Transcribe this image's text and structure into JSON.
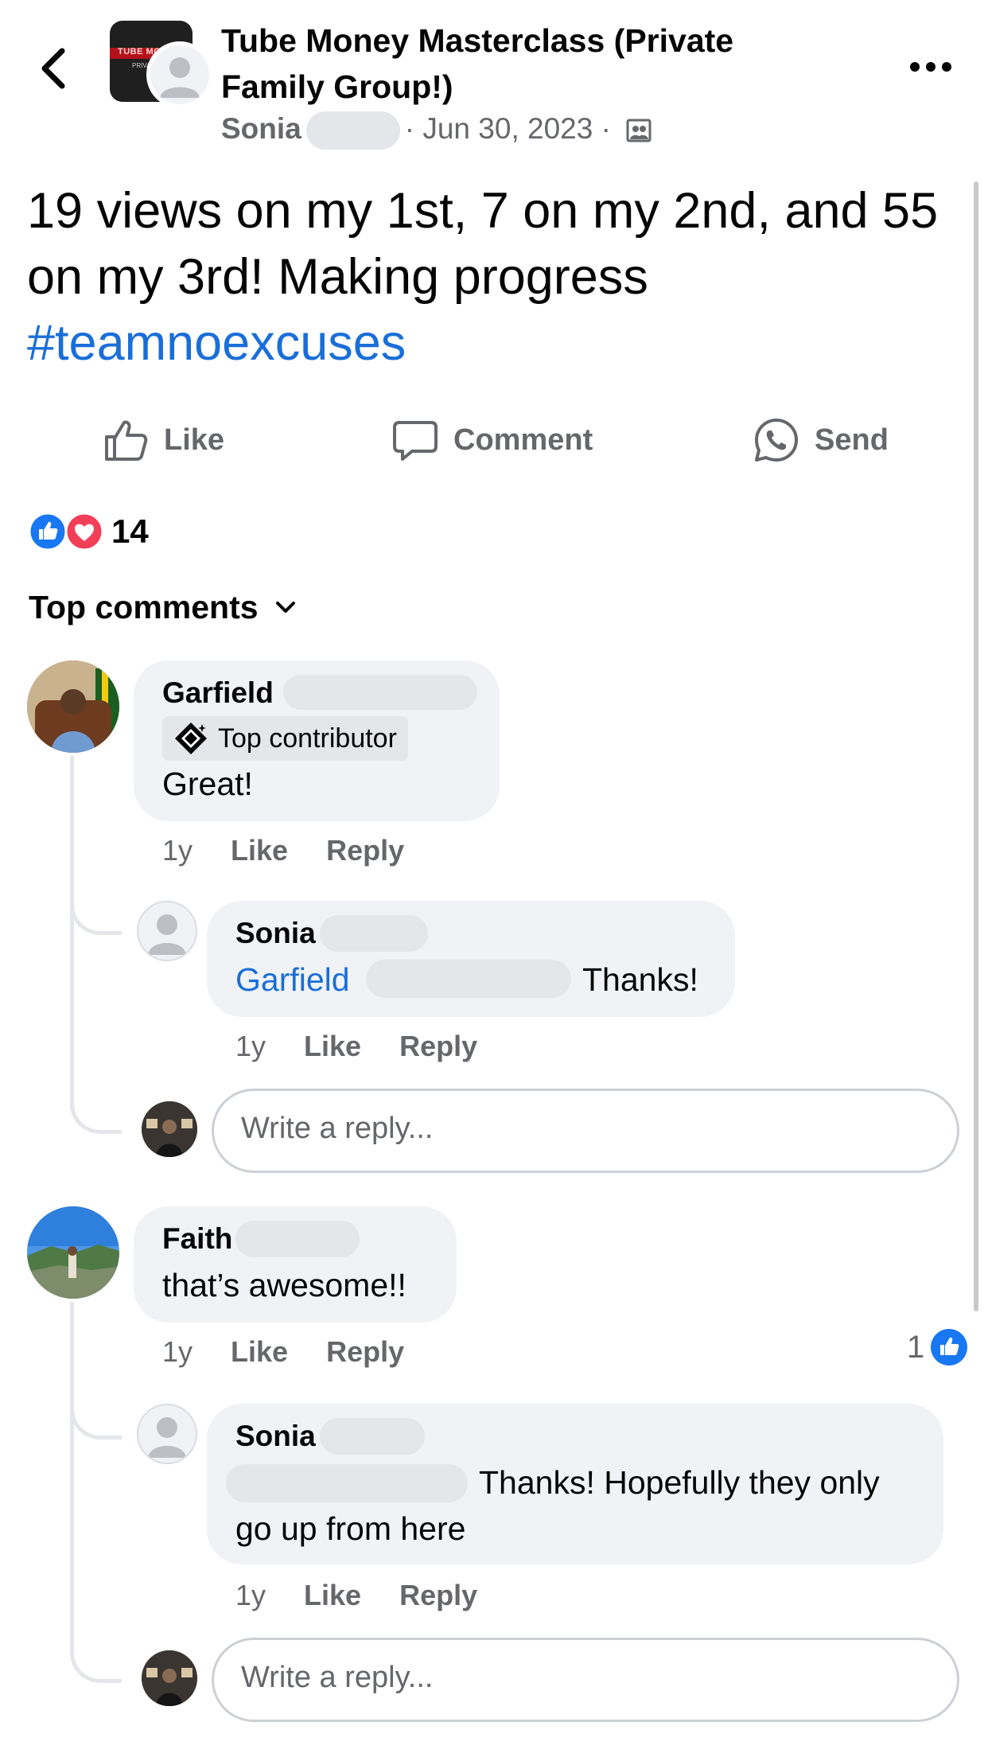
{
  "header": {
    "group_name": "Tube Money Masterclass (Private Family Group!)",
    "group_avatar_text": "TUBE MONEY",
    "group_avatar_subtext": "PRIVATE F",
    "author": "Sonia",
    "date": "Jun 30, 2023",
    "separator": "·",
    "audience_icon": "members-icon"
  },
  "post": {
    "text": "19 views on my 1st, 7 on my 2nd, and 55 on my 3rd! Making progress",
    "hashtag": "#teamnoexcuses"
  },
  "actions": {
    "like": "Like",
    "comment": "Comment",
    "send": "Send"
  },
  "reactions": {
    "count": "14",
    "types": [
      "like",
      "love"
    ]
  },
  "top_comments_label": "Top comments",
  "comments": [
    {
      "name": "Garfield",
      "badge": "Top contributor",
      "text": "Great!",
      "time": "1y",
      "like": "Like",
      "reply": "Reply",
      "replies": [
        {
          "name": "Sonia",
          "mention": "Garfield",
          "text": "Thanks!",
          "time": "1y",
          "like": "Like",
          "reply": "Reply"
        }
      ],
      "reply_placeholder": "Write a reply..."
    },
    {
      "name": "Faith",
      "text": "that’s awesome!!",
      "time": "1y",
      "like": "Like",
      "reply": "Reply",
      "like_count": "1",
      "replies": [
        {
          "name": "Sonia",
          "text_line1": "Thanks! Hopefully they only",
          "text_line2": "go up from here",
          "time": "1y",
          "like": "Like",
          "reply": "Reply"
        }
      ],
      "reply_placeholder": "Write a reply..."
    }
  ],
  "colors": {
    "link_blue": "#1a6ed8",
    "bubble_bg": "#f0f2f5",
    "meta_gray": "#65676b",
    "love_red": "#f33e58",
    "like_blue": "#1877f2"
  }
}
